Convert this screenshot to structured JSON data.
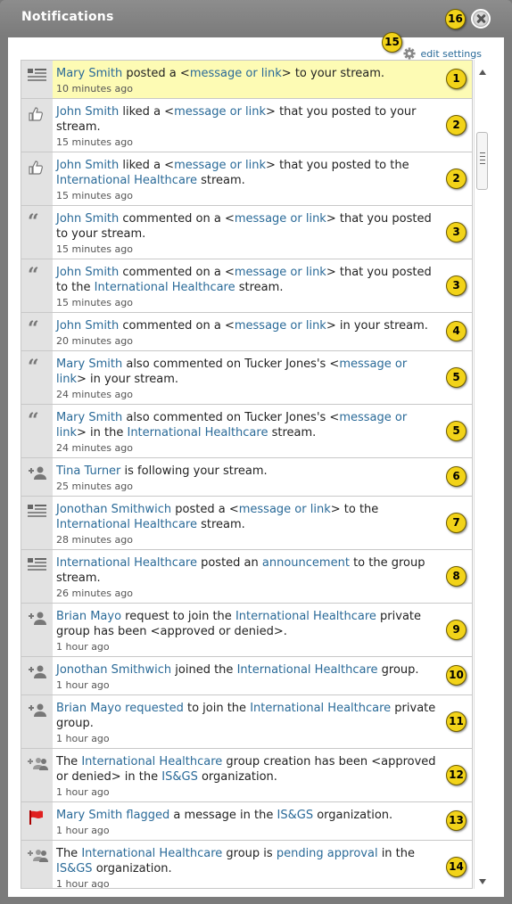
{
  "window": {
    "title": "Notifications"
  },
  "settings": {
    "label": "edit settings"
  },
  "notifications": [
    {
      "icon": "stream-post-icon",
      "parts": [
        [
          "Mary Smith",
          1
        ],
        [
          " posted a <",
          0
        ],
        [
          "message or link",
          1
        ],
        [
          "> to your stream.",
          0
        ]
      ],
      "time": "10 minutes ago",
      "badge": "1",
      "highlight": true
    },
    {
      "icon": "thumbs-up-icon",
      "parts": [
        [
          "John Smith",
          1
        ],
        [
          " liked a <",
          0
        ],
        [
          "message or link",
          1
        ],
        [
          "> that you posted to your stream.",
          0
        ]
      ],
      "time": "15 minutes ago",
      "badge": "2"
    },
    {
      "icon": "thumbs-up-icon",
      "parts": [
        [
          "John Smith",
          1
        ],
        [
          " liked a <",
          0
        ],
        [
          "message or link",
          1
        ],
        [
          "> that you posted to the ",
          0
        ],
        [
          "International Healthcare",
          1
        ],
        [
          " stream.",
          0
        ]
      ],
      "time": "15 minutes ago",
      "badge": "2"
    },
    {
      "icon": "quote-icon",
      "parts": [
        [
          "John Smith",
          1
        ],
        [
          " commented on a <",
          0
        ],
        [
          "message or link",
          1
        ],
        [
          "> that you posted to your stream.",
          0
        ]
      ],
      "time": "15 minutes ago",
      "badge": "3"
    },
    {
      "icon": "quote-icon",
      "parts": [
        [
          "John Smith",
          1
        ],
        [
          " commented on a <",
          0
        ],
        [
          "message or link",
          1
        ],
        [
          "> that you posted to the ",
          0
        ],
        [
          "International Healthcare",
          1
        ],
        [
          " stream.",
          0
        ]
      ],
      "time": "15 minutes ago",
      "badge": "3"
    },
    {
      "icon": "quote-icon",
      "parts": [
        [
          "John Smith",
          1
        ],
        [
          " commented on a <",
          0
        ],
        [
          "message or link",
          1
        ],
        [
          "> in your stream.",
          0
        ]
      ],
      "time": "20 minutes ago",
      "badge": "4"
    },
    {
      "icon": "quote-icon",
      "parts": [
        [
          "Mary Smith",
          1
        ],
        [
          " also commented on Tucker Jones's <",
          0
        ],
        [
          "message or link",
          1
        ],
        [
          "> in your stream.",
          0
        ]
      ],
      "time": "24 minutes ago",
      "badge": "5"
    },
    {
      "icon": "quote-icon",
      "parts": [
        [
          "Mary Smith",
          1
        ],
        [
          " also commented on Tucker Jones's <",
          0
        ],
        [
          "message or link",
          1
        ],
        [
          "> in the ",
          0
        ],
        [
          "International Healthcare",
          1
        ],
        [
          " stream.",
          0
        ]
      ],
      "time": "24 minutes ago",
      "badge": "5"
    },
    {
      "icon": "add-user-icon",
      "parts": [
        [
          "Tina Turner",
          1
        ],
        [
          " is following your stream.",
          0
        ]
      ],
      "time": "25 minutes ago",
      "badge": "6"
    },
    {
      "icon": "stream-post-icon",
      "parts": [
        [
          "Jonothan Smithwich",
          1
        ],
        [
          " posted a <",
          0
        ],
        [
          "message or link",
          1
        ],
        [
          "> to the ",
          0
        ],
        [
          "International Healthcare",
          1
        ],
        [
          " stream.",
          0
        ]
      ],
      "time": "28 minutes ago",
      "badge": "7"
    },
    {
      "icon": "stream-post-icon",
      "parts": [
        [
          "International Healthcare",
          1
        ],
        [
          " posted an ",
          0
        ],
        [
          "announcement",
          1
        ],
        [
          " to the group stream.",
          0
        ]
      ],
      "time": "26 minutes ago",
      "badge": "8"
    },
    {
      "icon": "add-user-icon",
      "parts": [
        [
          "Brian Mayo",
          1
        ],
        [
          " request to join the ",
          0
        ],
        [
          "International Healthcare",
          1
        ],
        [
          " private group has been <approved or denied>.",
          0
        ]
      ],
      "time": "1 hour ago",
      "badge": "9"
    },
    {
      "icon": "add-user-icon",
      "parts": [
        [
          "Jonothan Smithwich",
          1
        ],
        [
          " joined the ",
          0
        ],
        [
          "International Healthcare",
          1
        ],
        [
          " group.",
          0
        ]
      ],
      "time": "1 hour ago",
      "badge": "10"
    },
    {
      "icon": "add-user-icon",
      "parts": [
        [
          "Brian Mayo requested",
          1
        ],
        [
          " to join the ",
          0
        ],
        [
          "International Healthcare",
          1
        ],
        [
          " private group.",
          0
        ]
      ],
      "time": "1 hour ago",
      "badge": "11"
    },
    {
      "icon": "add-group-icon",
      "parts": [
        [
          "The ",
          0
        ],
        [
          "International Healthcare",
          1
        ],
        [
          " group creation has been <approved or denied> in the ",
          0
        ],
        [
          "IS&GS",
          1
        ],
        [
          " organization.",
          0
        ]
      ],
      "time": "1 hour ago",
      "badge": "12"
    },
    {
      "icon": "flag-icon",
      "parts": [
        [
          "Mary Smith flagged",
          1
        ],
        [
          " a message in the ",
          0
        ],
        [
          "IS&GS",
          1
        ],
        [
          " organization.",
          0
        ]
      ],
      "time": "1 hour ago",
      "badge": "13"
    },
    {
      "icon": "add-group-icon",
      "parts": [
        [
          "The ",
          0
        ],
        [
          "International Healthcare",
          1
        ],
        [
          " group is ",
          0
        ],
        [
          "pending approval",
          1
        ],
        [
          " in the ",
          0
        ],
        [
          "IS&GS",
          1
        ],
        [
          " organization.",
          0
        ]
      ],
      "time": "1 hour ago",
      "badge": "14"
    }
  ],
  "callouts": {
    "settings_badge": "15",
    "close_badge": "16"
  }
}
